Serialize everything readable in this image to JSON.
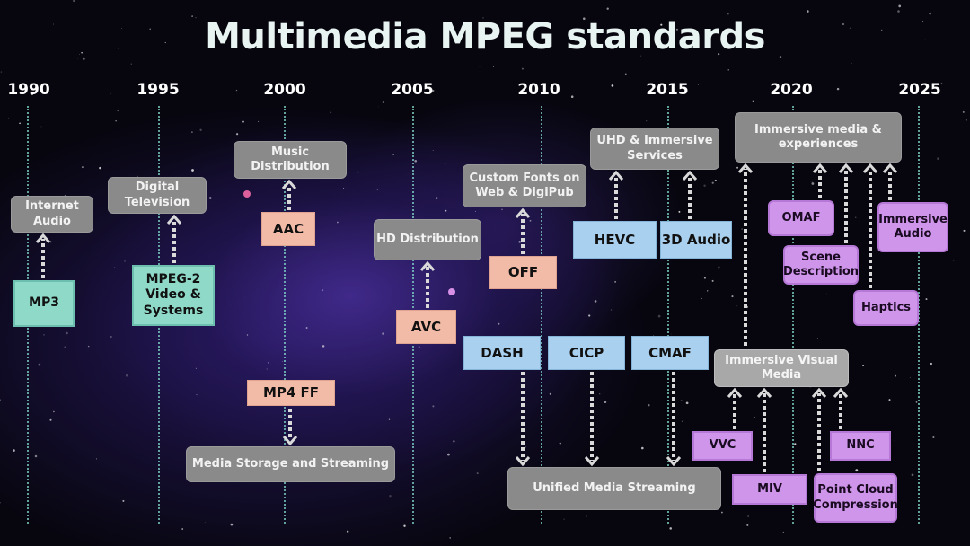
{
  "title": "Multimedia MPEG standards",
  "timeline": {
    "years": [
      "1990",
      "1995",
      "2000",
      "2005",
      "2010",
      "2015",
      "2020",
      "2025"
    ]
  },
  "applications": {
    "internet_audio": "Internet Audio",
    "digital_television": "Digital Television",
    "music_distribution": "Music Distribution",
    "hd_distribution": "HD Distribution",
    "custom_fonts": "Custom Fonts on Web & DigiPub",
    "uhd_immersive": "UHD & Immersive Services",
    "immersive_media": "Immersive media & experiences",
    "media_storage": "Media Storage and Streaming",
    "unified_streaming": "Unified Media Streaming",
    "immersive_visual": "Immersive Visual Media"
  },
  "standards": {
    "mp3": "MP3",
    "mpeg2": "MPEG-2 Video & Systems",
    "aac": "AAC",
    "mp4ff": "MP4 FF",
    "avc": "AVC",
    "off": "OFF",
    "hevc": "HEVC",
    "audio3d": "3D Audio",
    "dash": "DASH",
    "cicp": "CICP",
    "cmaf": "CMAF",
    "omaf": "OMAF",
    "scene_description": "Scene Description",
    "immersive_audio": "Immersive Audio",
    "haptics": "Haptics",
    "vvc": "VVC",
    "miv": "MIV",
    "nnc": "NNC",
    "pcc": "Point Cloud Compression"
  },
  "colors": {
    "application": "#8a8a8a",
    "era_1990s": "#8fd9c8",
    "era_2000s": "#f2bba8",
    "era_2010s": "#a9d0ee",
    "era_2020s": "#cf95ea",
    "timeline_line": "#7fd6c8"
  }
}
